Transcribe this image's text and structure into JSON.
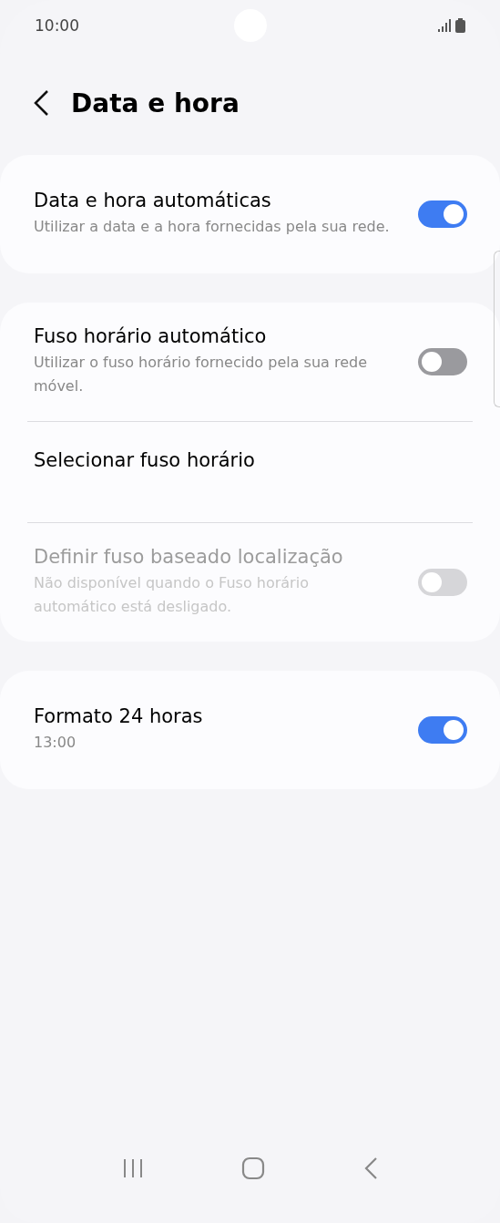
{
  "status_bar": {
    "time": "10:00"
  },
  "header": {
    "title": "Data e hora"
  },
  "groups": [
    {
      "items": [
        {
          "kind": "toggle",
          "title": "Data e hora automáticas",
          "subtitle": "Utilizar a data e a hora fornecidas pela sua rede.",
          "on": true,
          "disabled": false
        }
      ]
    },
    {
      "items": [
        {
          "kind": "toggle",
          "title": "Fuso horário automático",
          "subtitle": "Utilizar o fuso horário fornecido pela sua rede móvel.",
          "on": false,
          "disabled": false
        },
        {
          "kind": "plain",
          "title": "Selecionar fuso horário",
          "disabled": false
        },
        {
          "kind": "toggle",
          "title": "Definir fuso baseado localização",
          "subtitle": "Não disponível quando o Fuso horário automático está desligado.",
          "on": false,
          "disabled": true
        }
      ]
    },
    {
      "items": [
        {
          "kind": "toggle",
          "title": "Formato 24 horas",
          "subtitle": "13:00",
          "on": true,
          "disabled": false
        }
      ]
    }
  ]
}
